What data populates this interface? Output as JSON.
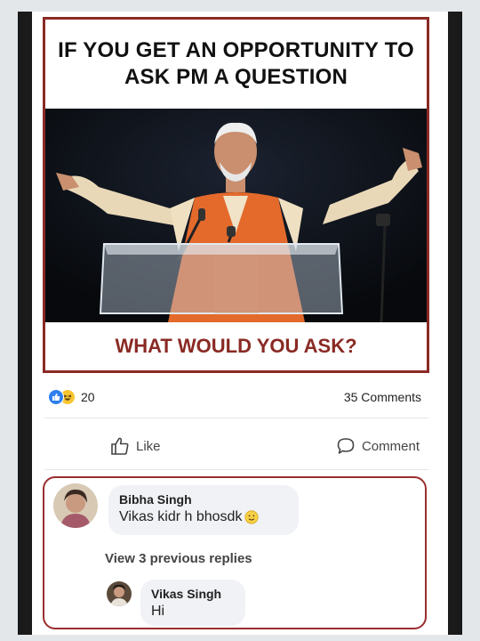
{
  "meme": {
    "top_text": "IF YOU GET AN OPPORTUNITY TO ASK PM A QUESTION",
    "bottom_text": "WHAT WOULD YOU ASK?"
  },
  "reactions": {
    "icons": [
      "like-reaction-icon",
      "haha-reaction-icon"
    ],
    "count": "20"
  },
  "comments_count": "35 Comments",
  "actions": {
    "like_label": "Like",
    "comment_label": "Comment"
  },
  "comments": {
    "first": {
      "author": "Bibha Singh",
      "text": "Vikas kidr h bhosdk",
      "emoji": "slightly-smiling-emoji"
    },
    "view_replies": "View 3 previous replies",
    "reply": {
      "author": "Vikas Singh",
      "text": "Hi"
    }
  },
  "colors": {
    "meme_border": "#8a2a24",
    "meme_bottom_text": "#8a2a24",
    "like_blue": "#2d7ff0",
    "haha_yellow": "#f7c531",
    "highlight_border": "#9a2e2e"
  }
}
